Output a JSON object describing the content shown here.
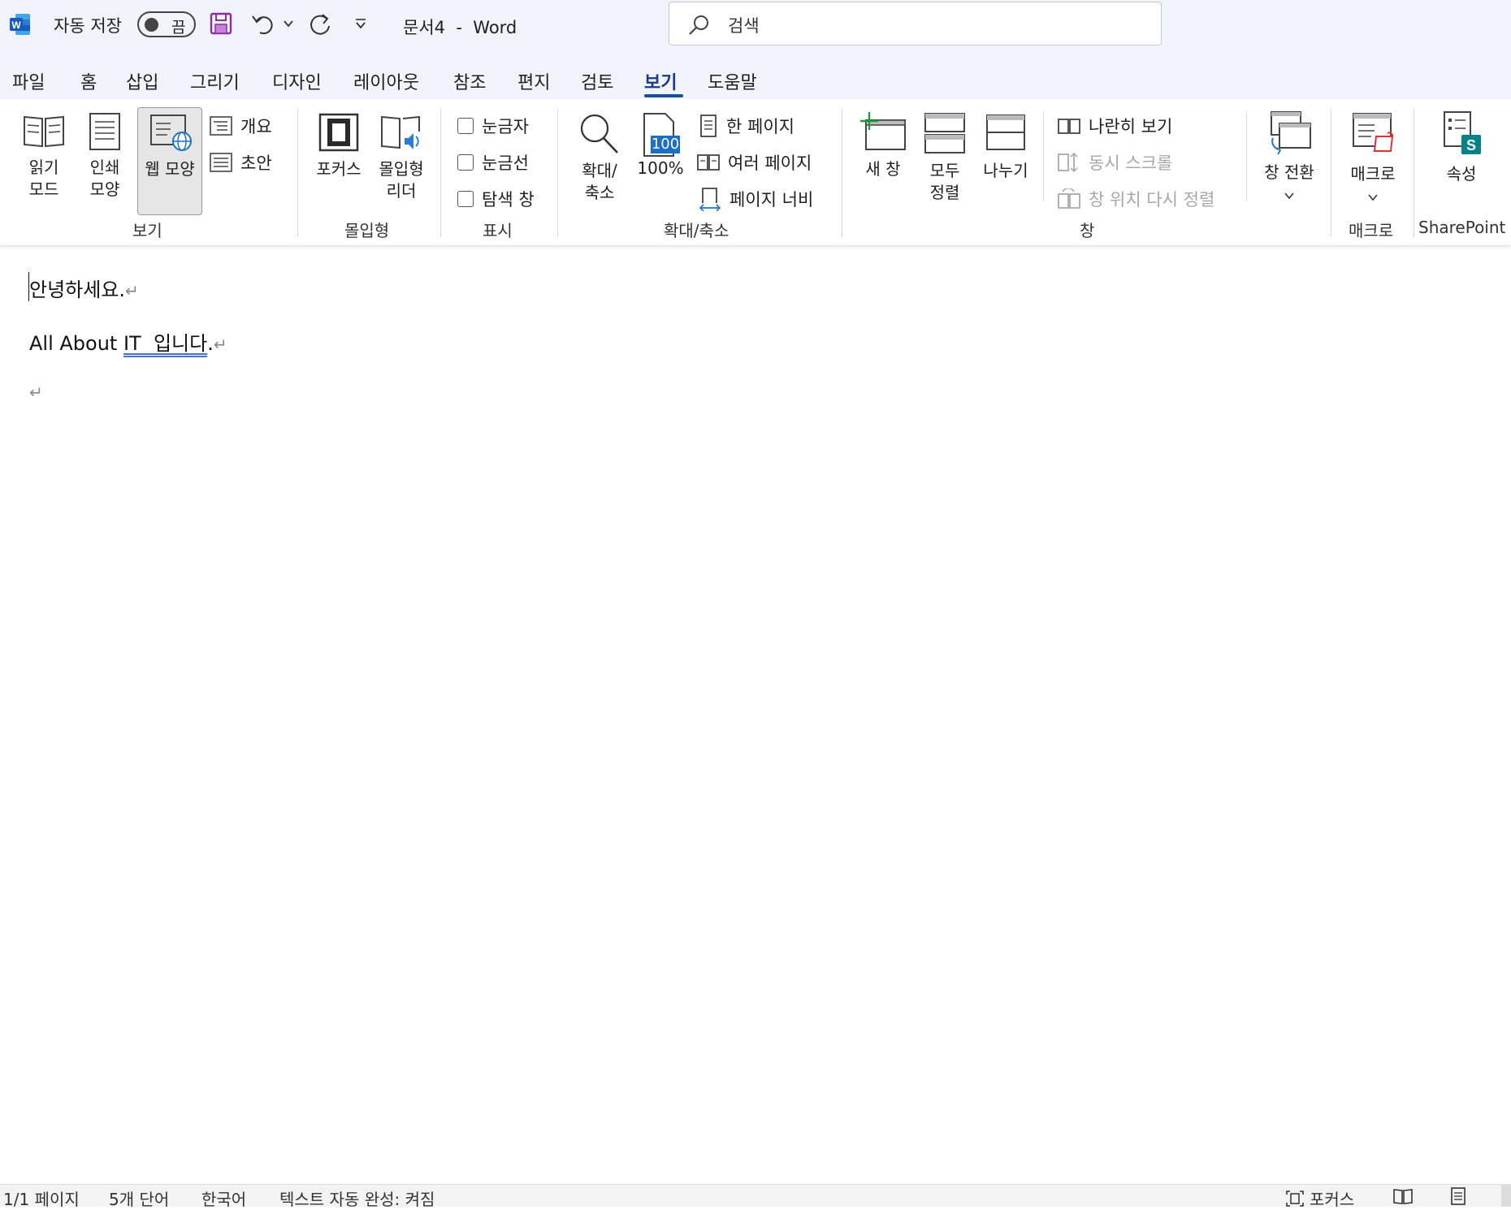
{
  "titlebar": {
    "autosave_label": "자동 저장",
    "autosave_state": "끔",
    "document_title": "문서4  -  Word",
    "search_placeholder": "검색"
  },
  "menu": {
    "tabs": [
      "파일",
      "홈",
      "삽입",
      "그리기",
      "디자인",
      "레이아웃",
      "참조",
      "편지",
      "검토",
      "보기",
      "도움말"
    ],
    "active_tab": "보기"
  },
  "ribbon": {
    "view_group": {
      "label": "보기",
      "read_mode": [
        "읽기",
        "모드"
      ],
      "print_layout": [
        "인쇄",
        "모양"
      ],
      "web_layout": "웹 모양",
      "outline": "개요",
      "draft": "초안"
    },
    "immersive_group": {
      "label": "몰입형",
      "focus": "포커스",
      "immersive_reader": [
        "몰입형",
        "리더"
      ]
    },
    "show_group": {
      "label": "표시",
      "ruler": "눈금자",
      "gridlines": "눈금선",
      "nav_pane": "탐색 창"
    },
    "zoom_group": {
      "label": "확대/축소",
      "zoom": [
        "확대/",
        "축소"
      ],
      "hundred": "100%",
      "icon_text": "100",
      "one_page": "한 페이지",
      "multiple_pages": "여러 페이지",
      "page_width": "페이지 너비"
    },
    "window_group": {
      "label": "창",
      "new_window": "새 창",
      "arrange_all": [
        "모두",
        "정렬"
      ],
      "split": "나누기",
      "side_by_side": "나란히 보기",
      "sync_scroll": "동시 스크롤",
      "reset_position": "창 위치 다시 정렬",
      "switch_windows": "창 전환"
    },
    "macros_group": {
      "label": "매크로",
      "macros": "매크로"
    },
    "sharepoint_group": {
      "label": "SharePoint",
      "properties": "속성"
    }
  },
  "document": {
    "line1": "안녕하세요.",
    "line2_prefix": "All About ",
    "line2_flag": "IT  입니다",
    "line2_suffix": ".",
    "pilcrow": "↵"
  },
  "statusbar": {
    "page": "1/1 페이지",
    "words": "5개 단어",
    "language": "한국어",
    "autocomplete": "텍스트 자동 완성: 켜짐",
    "focus": "포커스"
  },
  "colors": {
    "title_bg": "#f0f3f9",
    "accent": "#1a4fa0",
    "word_blue": "#185abd",
    "save_purple": "#8b2fa0"
  }
}
